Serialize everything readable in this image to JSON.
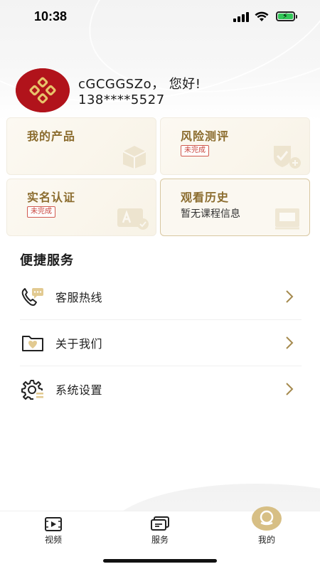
{
  "status_bar": {
    "time": "10:38"
  },
  "user": {
    "greeting": "cGCGGSZo， 您好!",
    "phone": "138****5527"
  },
  "cards": [
    {
      "title": "我的产品",
      "badge": "",
      "subtitle": "",
      "icon": "box-icon"
    },
    {
      "title": "风险测评",
      "badge": "未完成",
      "subtitle": "",
      "icon": "shield-check-icon"
    },
    {
      "title": "实名认证",
      "badge": "未完成",
      "subtitle": "",
      "icon": "id-card-icon"
    },
    {
      "title": "观看历史",
      "badge": "",
      "subtitle": "暂无课程信息",
      "icon": "play-book-icon"
    }
  ],
  "quick_services": {
    "title": "便捷服务",
    "items": [
      {
        "label": "客服热线",
        "icon": "phone-chat-icon"
      },
      {
        "label": "关于我们",
        "icon": "folder-heart-icon"
      },
      {
        "label": "系统设置",
        "icon": "gear-icon"
      }
    ]
  },
  "tabbar": {
    "items": [
      {
        "label": "视频",
        "icon": "video-icon",
        "active": false
      },
      {
        "label": "服务",
        "icon": "service-icon",
        "active": false
      },
      {
        "label": "我的",
        "icon": "profile-icon",
        "active": true
      }
    ]
  },
  "colors": {
    "accent_gold": "#8b6c2e",
    "badge_red": "#c9453d",
    "avatar_red": "#b1131b"
  }
}
